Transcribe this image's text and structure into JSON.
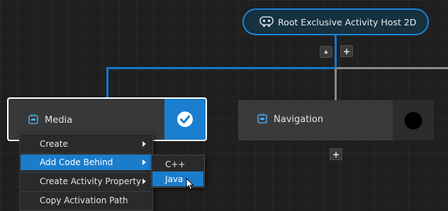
{
  "root_node": {
    "label": "Root Exclusive Activity Host 2D",
    "icon": "gamepad-icon"
  },
  "root_controls": {
    "collapse_symbol": "▲",
    "add_symbol": "+"
  },
  "nodes": {
    "media": {
      "label": "Media",
      "icon": "activity-node-icon",
      "state_icon": "checkmark-icon",
      "selected": true
    },
    "navigation": {
      "label": "Navigation",
      "icon": "activity-node-icon",
      "state_icon": "black-circle-icon",
      "add_symbol": "+"
    }
  },
  "context_menu": {
    "items": [
      {
        "label": "Create",
        "has_submenu": true
      },
      {
        "label": "Add Code Behind",
        "has_submenu": true,
        "highlighted": true
      },
      {
        "label": "Create Activity Property",
        "has_submenu": true
      },
      {
        "label": "Copy Activation Path",
        "has_submenu": false
      }
    ],
    "submenu": {
      "items": [
        {
          "label": "C++",
          "highlighted": false
        },
        {
          "label": "Java",
          "highlighted": true
        }
      ]
    }
  },
  "colors": {
    "accent": "#1a7dcc",
    "node_border_selected": "#ffffff",
    "background": "#1f1f1f"
  }
}
